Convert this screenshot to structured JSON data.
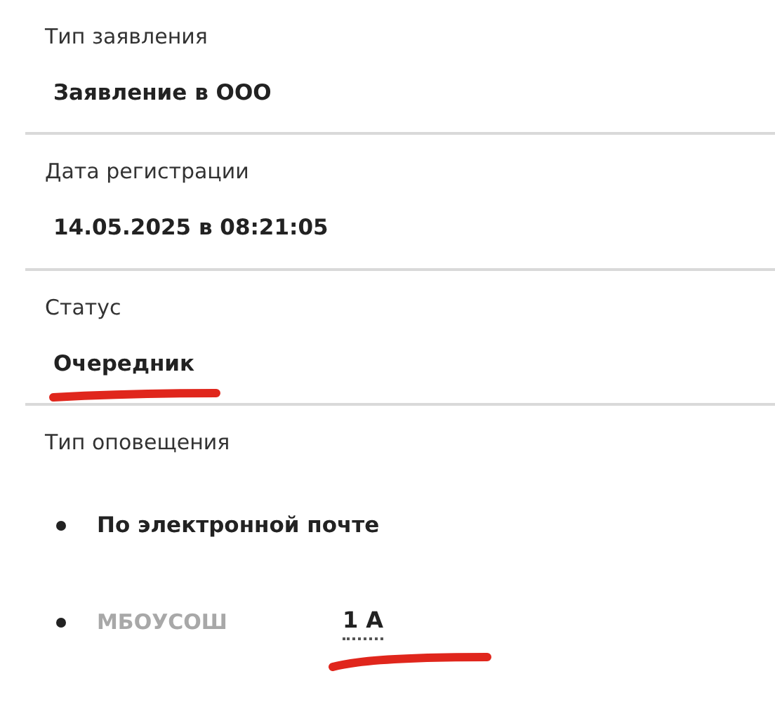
{
  "fields": [
    {
      "label": "Тип заявления",
      "value": "Заявление в ООО",
      "marked": false
    },
    {
      "label": "Дата регистрации",
      "value": "14.05.2025 в 08:21:05",
      "marked": false
    },
    {
      "label": "Статус",
      "value": "Очередник",
      "marked": true
    }
  ],
  "notification": {
    "label": "Тип оповещения",
    "items": [
      {
        "kind": "text",
        "text": "По электронной почте"
      },
      {
        "kind": "school",
        "text": "МБОУСОШ",
        "class_name": "1 А",
        "marked": true
      }
    ]
  }
}
